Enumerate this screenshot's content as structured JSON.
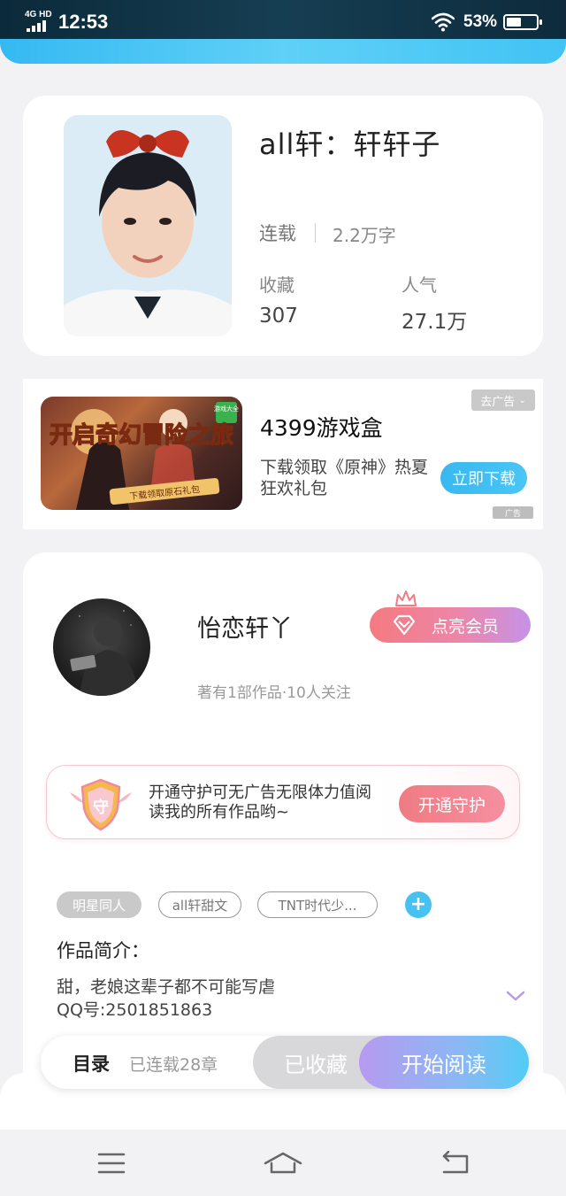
{
  "status_bar": {
    "network": "4G HD",
    "time": "12:53",
    "battery": "53%"
  },
  "book": {
    "title": "all轩：轩轩子",
    "status": "连载",
    "word_count": "2.2万字",
    "favorites_label": "收藏",
    "favorites_value": "307",
    "popularity_label": "人气",
    "popularity_value": "27.1万"
  },
  "ad": {
    "close_label": "去广告",
    "title": "4399游戏盒",
    "description": "下载领取《原神》热夏狂欢礼包",
    "download_label": "立即下载",
    "ad_mark": "广告",
    "image_text_main": "开启奇幻冒险之旅",
    "image_text_sub": "下载领取原石礼包",
    "image_badge": "游戏大全"
  },
  "author": {
    "name": "怡恋轩丫",
    "meta": "著有1部作品·10人关注",
    "vip_label": "点亮会员"
  },
  "guard": {
    "badge": "守",
    "text": "开通守护可无广告无限体力值阅读我的所有作品哟~",
    "button_label": "开通守护"
  },
  "tags": [
    "明星同人",
    "all轩甜文",
    "TNT时代少..."
  ],
  "intro": {
    "title": "作品简介：",
    "line1": "甜，老娘这辈子都不可能写虐",
    "line2": "QQ号:2501851863"
  },
  "action_bar": {
    "toc_label": "目录",
    "chapters_label": "已连载28章",
    "collected_label": "已收藏",
    "read_label": "开始阅读"
  },
  "colors": {
    "accent_blue": "#45c2f2",
    "pink": "#f07b82",
    "purple": "#b69af0"
  }
}
